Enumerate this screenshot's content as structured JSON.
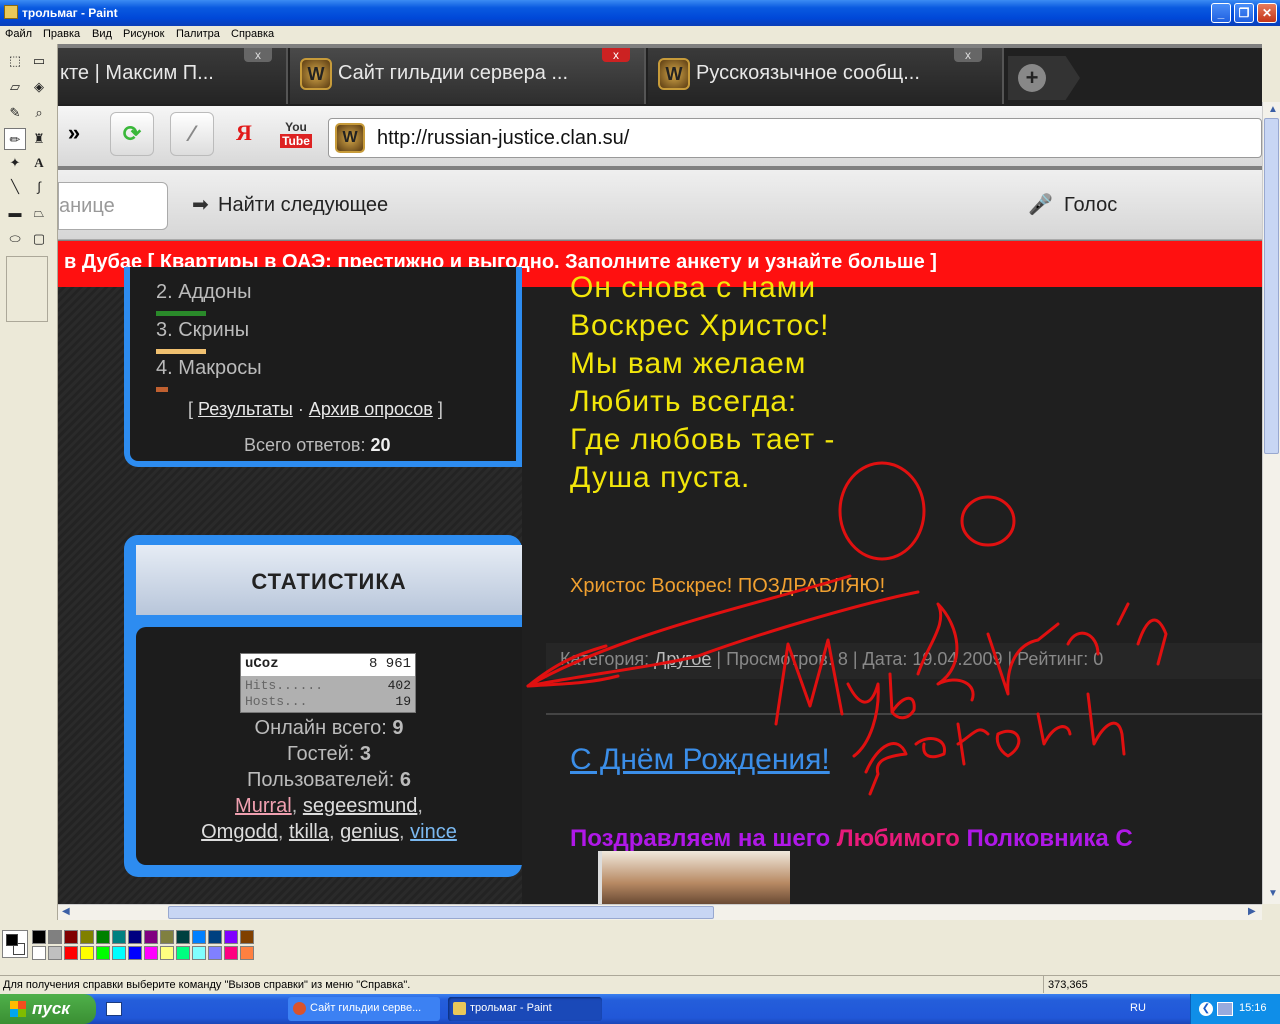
{
  "window": {
    "title": "трольмаг - Paint",
    "min": "_",
    "max": "❐",
    "close": "✕"
  },
  "menu": [
    "Файл",
    "Правка",
    "Вид",
    "Рисунок",
    "Палитра",
    "Справка"
  ],
  "tools": [
    "select-free-icon",
    "select-rect-icon",
    "eraser-icon",
    "fill-icon",
    "picker-icon",
    "magnifier-icon",
    "pencil-icon",
    "brush-icon",
    "airbrush-icon",
    "text-icon",
    "line-icon",
    "curve-icon",
    "rectangle-icon",
    "polygon-icon",
    "ellipse-icon",
    "rounded-rect-icon"
  ],
  "palette": {
    "fg": "#000000",
    "bg": "#ffffff",
    "colors": [
      "#000000",
      "#808080",
      "#800000",
      "#808000",
      "#008000",
      "#008080",
      "#000080",
      "#800080",
      "#808040",
      "#004040",
      "#0080ff",
      "#004080",
      "#8000ff",
      "#804000",
      "#ffffff",
      "#c0c0c0",
      "#ff0000",
      "#ffff00",
      "#00ff00",
      "#00ffff",
      "#0000ff",
      "#ff00ff",
      "#ffff80",
      "#00ff80",
      "#80ffff",
      "#8080ff",
      "#ff0080",
      "#ff8040"
    ]
  },
  "status": {
    "help": "Для получения справки выберите команду \"Вызов справки\" из меню \"Справка\".",
    "coords": "373,365"
  },
  "taskbar": {
    "start": "пуск",
    "tasks": [
      "Сайт гильдии серве...",
      "трольмаг - Paint"
    ],
    "lang": "RU",
    "clock": "15:16"
  },
  "browser": {
    "tabs": [
      {
        "label": "кте | Максим П..."
      },
      {
        "label": "Сайт гильдии сервера ..."
      },
      {
        "label": "Русскоязычное сообщ..."
      }
    ],
    "url": "http://russian-justice.clan.su/",
    "find_placeholder": "анице",
    "find_next": "Найти следующее",
    "voice": "Голос",
    "ad": "в Дубае  [ Квартиры в ОАЭ: престижно и выгодно. Заполните анкету и узнайте больше ]"
  },
  "poll": {
    "items": [
      "2. Аддоны",
      "3. Скрины",
      "4. Макросы"
    ],
    "results_link": "Результаты",
    "archive_link": "Архив опросов",
    "total_label": "Всего ответов:",
    "total_value": "20"
  },
  "stats": {
    "title": "СТАТИСТИКА",
    "counter": {
      "brand": "uCoz",
      "total": "8 961",
      "hits_label": "Hits......",
      "hits": "402",
      "hosts_label": "Hosts...",
      "hosts": "19"
    },
    "online_label": "Онлайн всего:",
    "online": "9",
    "guests_label": "Гостей:",
    "guests": "3",
    "users_label": "Пользователей:",
    "users": "6",
    "users_list": [
      "Murral",
      "segeesmund",
      "Omgodd",
      "tkilla",
      "genius",
      "vince"
    ]
  },
  "post": {
    "poem": [
      "Он снова с нами",
      "Воскрес Христос!",
      "Мы вам желаем",
      "Любить всегда:",
      "Где любовь тает -",
      "Душа пуста."
    ],
    "greeting": "Христос Воскрес! ПОЗДРАВЛЯЮ!",
    "meta_category_label": "Категория:",
    "meta_category": "Другое",
    "meta_rest": "| Просмотров: 8 | Дата: 19.04.2009 | Рейтинг: 0",
    "birthday_link": "С Днём Рождения!",
    "congrats_a": "Поздравляем на шего ",
    "congrats_b": "Любимого ",
    "congrats_c": "Полковника С"
  },
  "scribble_text": "Мы бьем рекорды"
}
